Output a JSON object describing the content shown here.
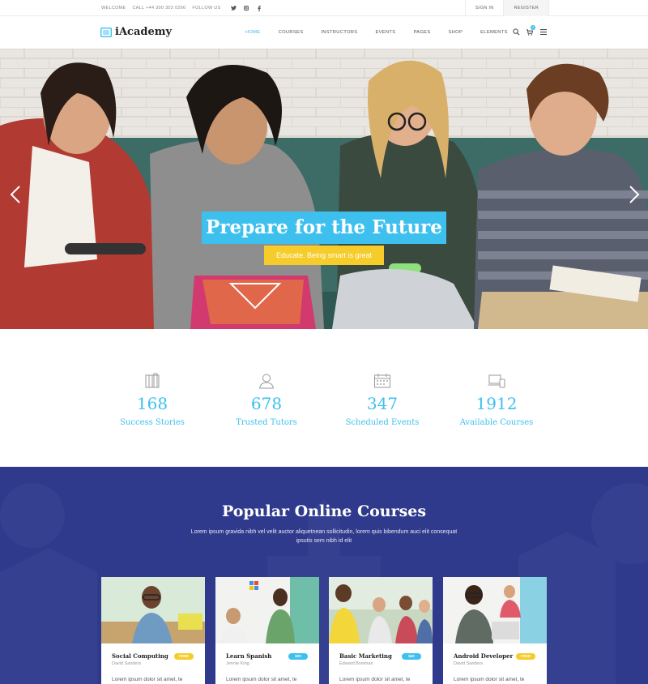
{
  "topbar": {
    "welcome": "WELCOME",
    "call": "CALL +44 300 303 0266",
    "follow": "FOLLOW US",
    "social_icons": [
      "twitter-icon",
      "instagram-icon",
      "facebook-icon"
    ],
    "sign_in": "SIGN IN",
    "register": "REGISTER"
  },
  "navbar": {
    "logo": "iAcademy",
    "items": [
      "HOME",
      "COURSES",
      "INSTRUCTORS",
      "EVENTS",
      "PAGES",
      "SHOP",
      "ELEMENTS"
    ],
    "active": "HOME",
    "cart_count": "0"
  },
  "hero": {
    "title": "Prepare for the Future",
    "subtitle": "Educate. Being smart is great"
  },
  "stats": [
    {
      "icon": "book-icon",
      "number": "168",
      "label": "Success Stories"
    },
    {
      "icon": "user-icon",
      "number": "678",
      "label": "Trusted Tutors"
    },
    {
      "icon": "calendar-icon",
      "number": "347",
      "label": "Scheduled Events"
    },
    {
      "icon": "devices-icon",
      "number": "1912",
      "label": "Available Courses"
    }
  ],
  "courses": {
    "heading": "Popular Online Courses",
    "description": "Lorem ipsum gravida nibh vel velit auctor aliquetnean sollicitudin, lorem quis bibendum auci elit consequat ipsutis sem nibh id elit",
    "cards": [
      {
        "title": "Social Computing",
        "author": "David Sanders",
        "badge": "FREE",
        "badge_color": "#f6cc2a",
        "text": "Lorem ipsum dolor sit amet, te"
      },
      {
        "title": "Learn Spanish",
        "author": "Jennie King",
        "badge": "$20",
        "badge_color": "#3ec0ef",
        "text": "Lorem ipsum dolor sit amet, te"
      },
      {
        "title": "Basic Marketing",
        "author": "Edward Bowman",
        "badge": "$40",
        "badge_color": "#3ec0ef",
        "text": "Lorem ipsum dolor sit amet, te"
      },
      {
        "title": "Android Developer",
        "author": "David Sanders",
        "badge": "FREE",
        "badge_color": "#f6cc2a",
        "text": "Lorem ipsum dolor sit amet, te"
      }
    ]
  },
  "colors": {
    "accent": "#3ec0ef",
    "yellow": "#f6cc2a",
    "navy": "#2f3a8c"
  }
}
